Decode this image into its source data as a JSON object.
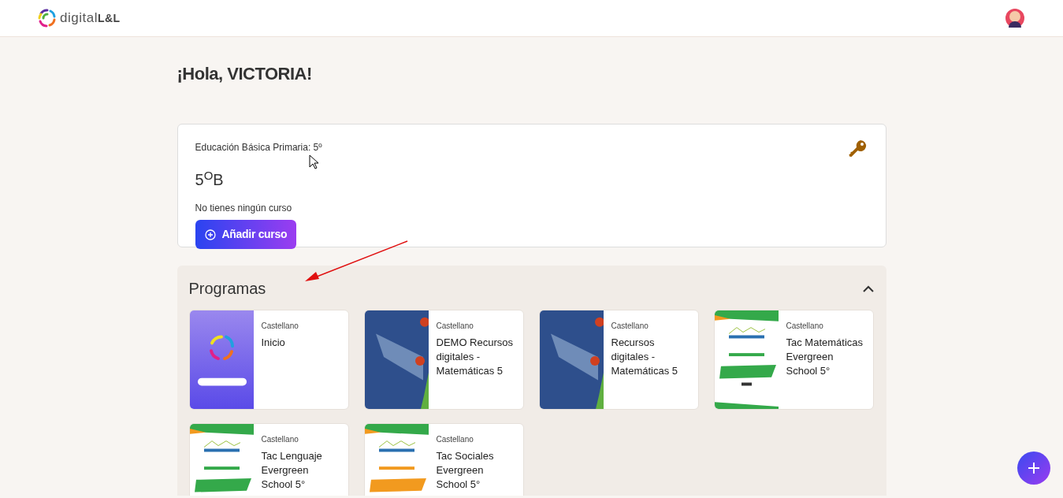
{
  "header": {
    "logo_text": "digital",
    "logo_bold": "L&L"
  },
  "greeting": "¡Hola, VICTORIA!",
  "class_card": {
    "level": "Educación Básica Primaria: 5º",
    "group": "5$^{O}$B",
    "empty_message": "No tienes ningún curso",
    "add_button": "Añadir curso"
  },
  "programs": {
    "title": "Programas",
    "expanded": true,
    "items": [
      {
        "subject": "Castellano",
        "title": "Inicio",
        "kind": "brand"
      },
      {
        "subject": "Castellano",
        "title": "DEMO Recursos digitales - Matemáticas 5",
        "kind": "photo"
      },
      {
        "subject": "Castellano",
        "title": "Recursos digitales - Matemáticas 5",
        "kind": "photo"
      },
      {
        "subject": "Castellano",
        "title": "Tac Matemáticas Evergreen School 5°",
        "kind": "evergreen",
        "color": "#34a94a"
      },
      {
        "subject": "Castellano",
        "title": "Tac Lenguaje Evergreen School 5°",
        "kind": "evergreen",
        "color": "#34a94a"
      },
      {
        "subject": "Castellano",
        "title": "Tac Sociales Evergreen School 5°",
        "kind": "evergreen",
        "color": "#f29a1f"
      }
    ]
  }
}
